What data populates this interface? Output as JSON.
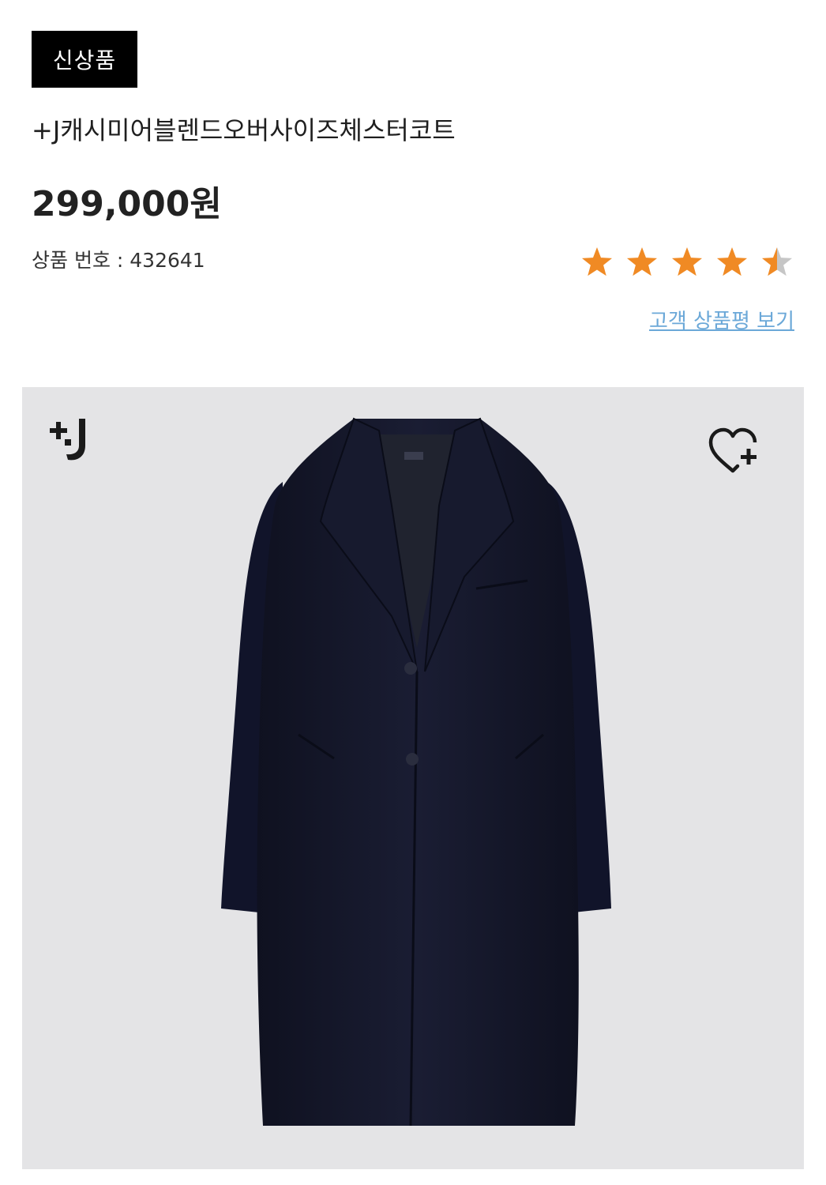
{
  "badge": {
    "label": "신상품"
  },
  "product": {
    "title": "+J캐시미어블렌드오버사이즈체스터코트",
    "price": "299,000원",
    "product_number": "상품 번호 : 432641",
    "rating": 4.5,
    "rating_max": 5,
    "review_link": "고객 상품평 보기"
  },
  "image": {
    "brand_logo": "+J",
    "wishlist_icon": "heart-plus-icon",
    "background_color": "#e4e4e6",
    "coat_color": "#141728"
  },
  "colors": {
    "star_filled": "#f08a24",
    "star_empty": "#c6c6c6",
    "link": "#6ba8d8"
  }
}
